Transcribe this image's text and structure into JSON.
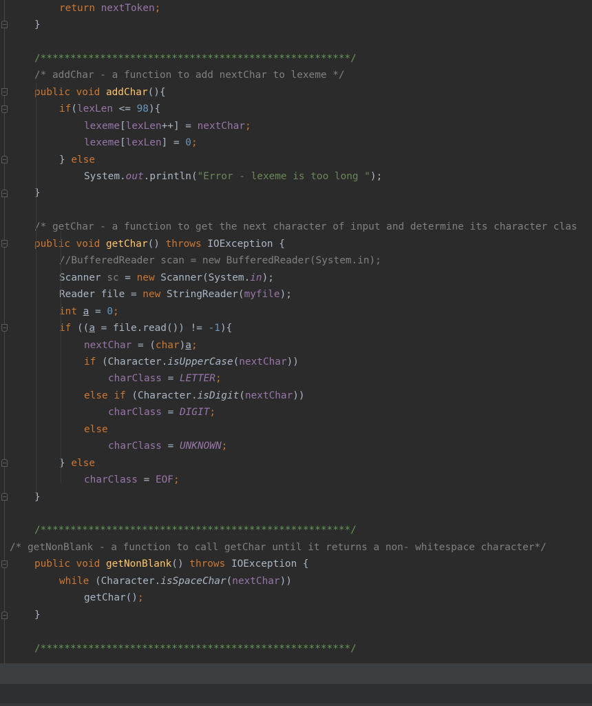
{
  "editor": {
    "language": "java",
    "lines": [
      {
        "id": "l1",
        "tokens": [
          {
            "t": "return",
            "c": "kw"
          },
          {
            "t": " nextToken",
            "c": "fld"
          },
          {
            "t": ";",
            "c": "kw"
          }
        ]
      },
      {
        "id": "l2",
        "tokens": [
          {
            "t": "}",
            "c": ""
          }
        ]
      },
      {
        "id": "l3",
        "tokens": []
      },
      {
        "id": "l4",
        "tokens": [
          {
            "t": "/****************************************************/",
            "c": "doc"
          }
        ]
      },
      {
        "id": "l5",
        "tokens": [
          {
            "t": "/* addChar - a function to add nextChar to lexeme */",
            "c": "cmt"
          }
        ]
      },
      {
        "id": "l6",
        "tokens": [
          {
            "t": "public void ",
            "c": "kw"
          },
          {
            "t": "addChar",
            "c": "fn"
          },
          {
            "t": "(){",
            "c": ""
          }
        ]
      },
      {
        "id": "l7",
        "tokens": [
          {
            "t": "if",
            "c": "kw"
          },
          {
            "t": "(",
            "c": ""
          },
          {
            "t": "lexLen",
            "c": "fld"
          },
          {
            "t": " <= ",
            "c": ""
          },
          {
            "t": "98",
            "c": "num"
          },
          {
            "t": "){",
            "c": ""
          }
        ]
      },
      {
        "id": "l8",
        "tokens": [
          {
            "t": "lexeme",
            "c": "fld"
          },
          {
            "t": "[",
            "c": ""
          },
          {
            "t": "lexLen",
            "c": "fld"
          },
          {
            "t": "++] = ",
            "c": ""
          },
          {
            "t": "nextChar",
            "c": "fld"
          },
          {
            "t": ";",
            "c": "kw"
          }
        ]
      },
      {
        "id": "l9",
        "tokens": [
          {
            "t": "lexeme",
            "c": "fld"
          },
          {
            "t": "[",
            "c": ""
          },
          {
            "t": "lexLen",
            "c": "fld"
          },
          {
            "t": "] = ",
            "c": ""
          },
          {
            "t": "0",
            "c": "num"
          },
          {
            "t": ";",
            "c": "kw"
          }
        ]
      },
      {
        "id": "l10",
        "tokens": [
          {
            "t": "} ",
            "c": ""
          },
          {
            "t": "else",
            "c": "kw"
          }
        ]
      },
      {
        "id": "l11",
        "tokens": [
          {
            "t": "System.",
            "c": ""
          },
          {
            "t": "out",
            "c": "fi"
          },
          {
            "t": ".println(",
            "c": ""
          },
          {
            "t": "\"Error - lexeme is too long \"",
            "c": "str"
          },
          {
            "t": ");",
            "c": ""
          }
        ]
      },
      {
        "id": "l12",
        "tokens": [
          {
            "t": "}",
            "c": ""
          }
        ]
      },
      {
        "id": "l13",
        "tokens": []
      },
      {
        "id": "l14",
        "tokens": [
          {
            "t": "/* getChar - a function to get the next character of input and determine its character clas",
            "c": "cmt"
          }
        ]
      },
      {
        "id": "l15",
        "tokens": [
          {
            "t": "public void ",
            "c": "kw"
          },
          {
            "t": "getChar",
            "c": "fn"
          },
          {
            "t": "() ",
            "c": ""
          },
          {
            "t": "throws ",
            "c": "kw"
          },
          {
            "t": "IOException {",
            "c": ""
          }
        ]
      },
      {
        "id": "l16",
        "tokens": [
          {
            "t": "//BufferedReader scan = new BufferedReader(System.in);",
            "c": "cmt"
          }
        ]
      },
      {
        "id": "l17",
        "tokens": [
          {
            "t": "Scanner ",
            "c": ""
          },
          {
            "t": "sc",
            "c": "cmt"
          },
          {
            "t": " = ",
            "c": ""
          },
          {
            "t": "new ",
            "c": "kw"
          },
          {
            "t": "Scanner(System.",
            "c": ""
          },
          {
            "t": "in",
            "c": "fi"
          },
          {
            "t": ");",
            "c": ""
          }
        ]
      },
      {
        "id": "l18",
        "tokens": [
          {
            "t": "Reader file = ",
            "c": ""
          },
          {
            "t": "new ",
            "c": "kw"
          },
          {
            "t": "StringReader(",
            "c": ""
          },
          {
            "t": "myfile",
            "c": "fld"
          },
          {
            "t": ");",
            "c": ""
          }
        ]
      },
      {
        "id": "l19",
        "tokens": [
          {
            "t": "int ",
            "c": "kw"
          },
          {
            "t": "a",
            "c": "ul"
          },
          {
            "t": " = ",
            "c": ""
          },
          {
            "t": "0",
            "c": "num"
          },
          {
            "t": ";",
            "c": "kw"
          }
        ]
      },
      {
        "id": "l20",
        "tokens": [
          {
            "t": "if ",
            "c": "kw"
          },
          {
            "t": "((",
            "c": ""
          },
          {
            "t": "a",
            "c": "ul"
          },
          {
            "t": " = file.read()) != ",
            "c": ""
          },
          {
            "t": "-1",
            "c": "num"
          },
          {
            "t": "){",
            "c": ""
          }
        ]
      },
      {
        "id": "l21",
        "tokens": [
          {
            "t": "nextChar",
            "c": "fld"
          },
          {
            "t": " = (",
            "c": ""
          },
          {
            "t": "char",
            "c": "kw"
          },
          {
            "t": ")",
            "c": ""
          },
          {
            "t": "a",
            "c": "ul"
          },
          {
            "t": ";",
            "c": "kw"
          }
        ]
      },
      {
        "id": "l22",
        "tokens": [
          {
            "t": "if ",
            "c": "kw"
          },
          {
            "t": "(Character.",
            "c": ""
          },
          {
            "t": "isUpperCase",
            "c": "it"
          },
          {
            "t": "(",
            "c": ""
          },
          {
            "t": "nextChar",
            "c": "fld"
          },
          {
            "t": "))",
            "c": ""
          }
        ]
      },
      {
        "id": "l23",
        "tokens": [
          {
            "t": "charClass",
            "c": "fld"
          },
          {
            "t": " = ",
            "c": ""
          },
          {
            "t": "LETTER",
            "c": "fi"
          },
          {
            "t": ";",
            "c": "kw"
          }
        ]
      },
      {
        "id": "l24",
        "tokens": [
          {
            "t": "else if ",
            "c": "kw"
          },
          {
            "t": "(Character.",
            "c": ""
          },
          {
            "t": "isDigit",
            "c": "it"
          },
          {
            "t": "(",
            "c": ""
          },
          {
            "t": "nextChar",
            "c": "fld"
          },
          {
            "t": "))",
            "c": ""
          }
        ]
      },
      {
        "id": "l25",
        "tokens": [
          {
            "t": "charClass",
            "c": "fld"
          },
          {
            "t": " = ",
            "c": ""
          },
          {
            "t": "DIGIT",
            "c": "fi"
          },
          {
            "t": ";",
            "c": "kw"
          }
        ]
      },
      {
        "id": "l26",
        "tokens": [
          {
            "t": "else",
            "c": "kw"
          }
        ]
      },
      {
        "id": "l27",
        "tokens": [
          {
            "t": "charClass",
            "c": "fld"
          },
          {
            "t": " = ",
            "c": ""
          },
          {
            "t": "UNKNOWN",
            "c": "fi"
          },
          {
            "t": ";",
            "c": "kw"
          }
        ]
      },
      {
        "id": "l28",
        "tokens": [
          {
            "t": "} ",
            "c": ""
          },
          {
            "t": "else",
            "c": "kw"
          }
        ]
      },
      {
        "id": "l29",
        "tokens": [
          {
            "t": "charClass",
            "c": "fld"
          },
          {
            "t": " = ",
            "c": ""
          },
          {
            "t": "EOF",
            "c": "fld"
          },
          {
            "t": ";",
            "c": "kw"
          }
        ]
      },
      {
        "id": "l30",
        "tokens": [
          {
            "t": "}",
            "c": ""
          }
        ]
      },
      {
        "id": "l31",
        "tokens": []
      },
      {
        "id": "l32",
        "tokens": [
          {
            "t": "/****************************************************/",
            "c": "doc"
          }
        ]
      },
      {
        "id": "l33",
        "tokens": [
          {
            "t": "/* getNonBlank - a function to call getChar until it returns a non- whitespace character*/",
            "c": "cmt"
          }
        ]
      },
      {
        "id": "l34",
        "tokens": [
          {
            "t": "public void ",
            "c": "kw"
          },
          {
            "t": "getNonBlank",
            "c": "fn"
          },
          {
            "t": "() ",
            "c": ""
          },
          {
            "t": "throws ",
            "c": "kw"
          },
          {
            "t": "IOException {",
            "c": ""
          }
        ]
      },
      {
        "id": "l35",
        "tokens": [
          {
            "t": "while ",
            "c": "kw"
          },
          {
            "t": "(Character.",
            "c": ""
          },
          {
            "t": "isSpaceChar",
            "c": "it"
          },
          {
            "t": "(",
            "c": ""
          },
          {
            "t": "nextChar",
            "c": "fld"
          },
          {
            "t": "))",
            "c": ""
          }
        ]
      },
      {
        "id": "l36",
        "tokens": [
          {
            "t": "getChar()",
            "c": ""
          },
          {
            "t": ";",
            "c": "kw"
          }
        ]
      },
      {
        "id": "l37",
        "tokens": [
          {
            "t": "}",
            "c": ""
          }
        ]
      },
      {
        "id": "l38",
        "tokens": []
      },
      {
        "id": "l39",
        "tokens": [
          {
            "t": "/****************************************************/",
            "c": "doc"
          }
        ]
      }
    ]
  },
  "colors": {
    "background": "#2b2b2b",
    "keyword": "#cc7832",
    "method_decl": "#ffc66d",
    "field": "#9876aa",
    "number": "#6897bb",
    "string": "#6a8759",
    "comment": "#808080",
    "doc_comment": "#629755",
    "default_text": "#a9b7c6"
  }
}
